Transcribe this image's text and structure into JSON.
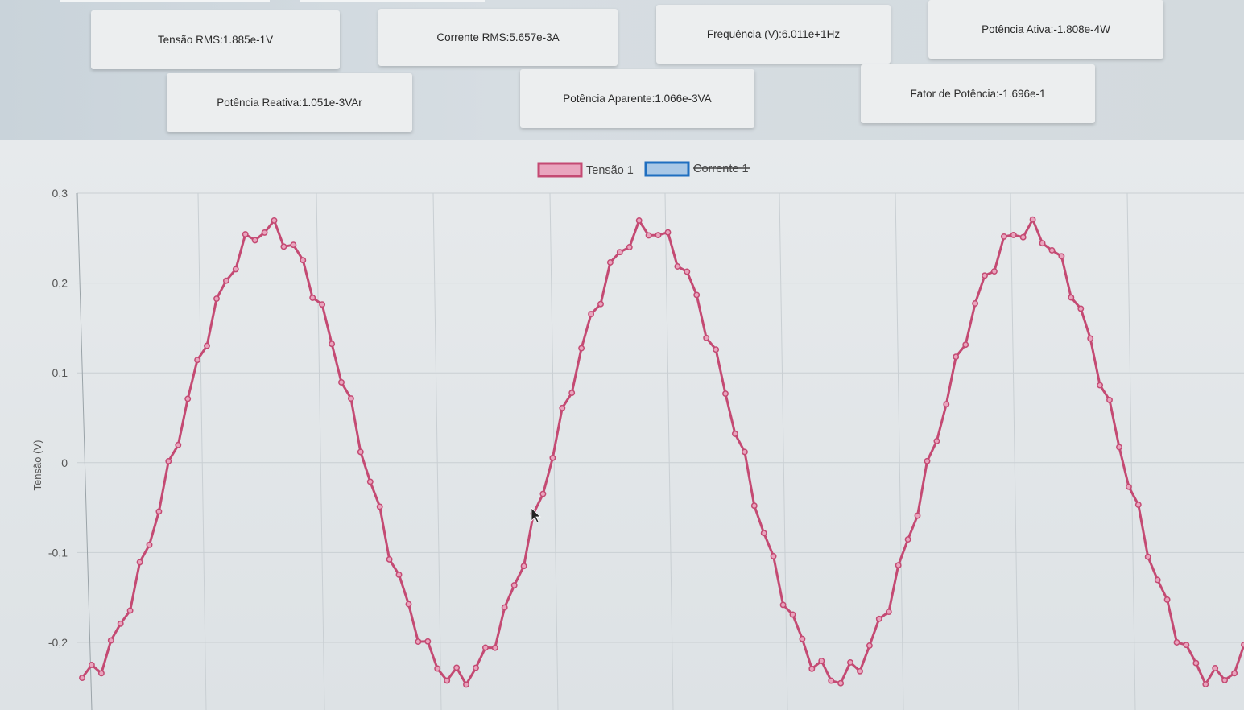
{
  "cards": {
    "tensao_rms": "Tensão RMS:1.885e-1V",
    "corrente_rms": "Corrente RMS:5.657e-3A",
    "frequencia": "Frequência (V):6.011e+1Hz",
    "potencia_ativa": "Potência Ativa:-1.808e-4W",
    "potencia_reativa": "Potência Reativa:1.051e-3VAr",
    "potencia_aparente": "Potência Aparente:1.066e-3VA",
    "fator_potencia": "Fator de Potência:-1.696e-1"
  },
  "chart_data": {
    "type": "line",
    "title": "",
    "ylabel": "Tensão (V)",
    "xlabel": "",
    "ylim": [
      -0.26,
      0.3
    ],
    "yticks": [
      0.3,
      0.2,
      0.1,
      0,
      -0.1,
      -0.2
    ],
    "ytick_labels": [
      "0,3",
      "0,2",
      "0,1",
      "0",
      "-0,1",
      "-0,2"
    ],
    "grid": true,
    "legend": "top-center",
    "series": [
      {
        "name": "Tensão 1",
        "color": "#c44a73",
        "fill": "#e9a5be",
        "visible": true,
        "amplitude": 0.25,
        "offset": 0.01,
        "period_samples": 39.5,
        "phase_samples": 9.5,
        "sample_count": 122
      },
      {
        "name": "Corrente 1",
        "color": "#1f6fc0",
        "fill": "#a9c8e6",
        "visible": false
      }
    ]
  }
}
